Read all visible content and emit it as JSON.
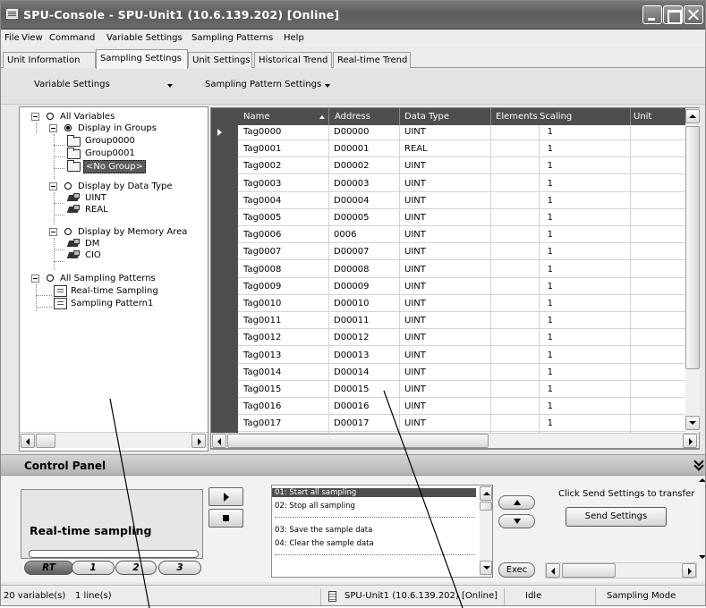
{
  "window": {
    "title": "SPU-Console - SPU-Unit1 (10.6.139.202) [Online]"
  },
  "menu": [
    "File",
    "View",
    "Command",
    "Variable Settings",
    "Sampling Patterns",
    "Help"
  ],
  "tabs": [
    "Unit Information",
    "Sampling Settings",
    "Unit Settings",
    "Historical Trend",
    "Real-time Trend"
  ],
  "toolbar": {
    "variable_settings": "Variable Settings",
    "sampling_pattern_settings": "Sampling Pattern Settings"
  },
  "tree": {
    "all_variables": "All Variables",
    "display_in_groups": "Display in Groups",
    "group0": "Group0000",
    "group1": "Group0001",
    "no_group": "<No Group>",
    "display_by_type": "Display by Data Type",
    "type_uint": "UINT",
    "type_real": "REAL",
    "display_by_area": "Display by Memory Area",
    "area_dm": "DM",
    "area_cio": "CIO",
    "all_patterns": "All Sampling Patterns",
    "pattern_rt": "Real-time Sampling",
    "pattern_1": "Sampling Pattern1"
  },
  "grid": {
    "columns": [
      "Name",
      "Address",
      "Data Type",
      "Elements",
      "Scaling",
      "Unit"
    ],
    "rows": [
      [
        "Tag0000",
        "D00000",
        "UINT",
        "1"
      ],
      [
        "Tag0001",
        "D00001",
        "REAL",
        "1"
      ],
      [
        "Tag0002",
        "D00002",
        "UINT",
        "1"
      ],
      [
        "Tag0003",
        "D00003",
        "UINT",
        "1"
      ],
      [
        "Tag0004",
        "D00004",
        "UINT",
        "1"
      ],
      [
        "Tag0005",
        "D00005",
        "UINT",
        "1"
      ],
      [
        "Tag0006",
        "0006",
        "UINT",
        "1"
      ],
      [
        "Tag0007",
        "D00007",
        "UINT",
        "1"
      ],
      [
        "Tag0008",
        "D00008",
        "UINT",
        "1"
      ],
      [
        "Tag0009",
        "D00009",
        "UINT",
        "1"
      ],
      [
        "Tag0010",
        "D00010",
        "UINT",
        "1"
      ],
      [
        "Tag0011",
        "D00011",
        "UINT",
        "1"
      ],
      [
        "Tag0012",
        "D00012",
        "UINT",
        "1"
      ],
      [
        "Tag0013",
        "D00013",
        "UINT",
        "1"
      ],
      [
        "Tag0014",
        "D00014",
        "UINT",
        "1"
      ],
      [
        "Tag0015",
        "D00015",
        "UINT",
        "1"
      ],
      [
        "Tag0016",
        "D00016",
        "UINT",
        "1"
      ],
      [
        "Tag0017",
        "D00017",
        "UINT",
        "1"
      ]
    ]
  },
  "control_panel": {
    "title": "Control Panel",
    "mode_label": "Real-time sampling",
    "buttons": [
      "RT",
      "1",
      "2",
      "3"
    ],
    "commands": [
      "01: Start all sampling",
      "02: Stop all sampling",
      "03: Save the sample data",
      "04: Clear the sample data"
    ],
    "exec": "Exec",
    "send_hint": "Click Send Settings to transfer",
    "send_button": "Send Settings"
  },
  "status": {
    "variables": "20 variable(s)",
    "lines": "1 line(s)",
    "unit": "SPU-Unit1 (10.6.139.202) [Online]",
    "state": "Idle",
    "mode": "Sampling Mode"
  }
}
